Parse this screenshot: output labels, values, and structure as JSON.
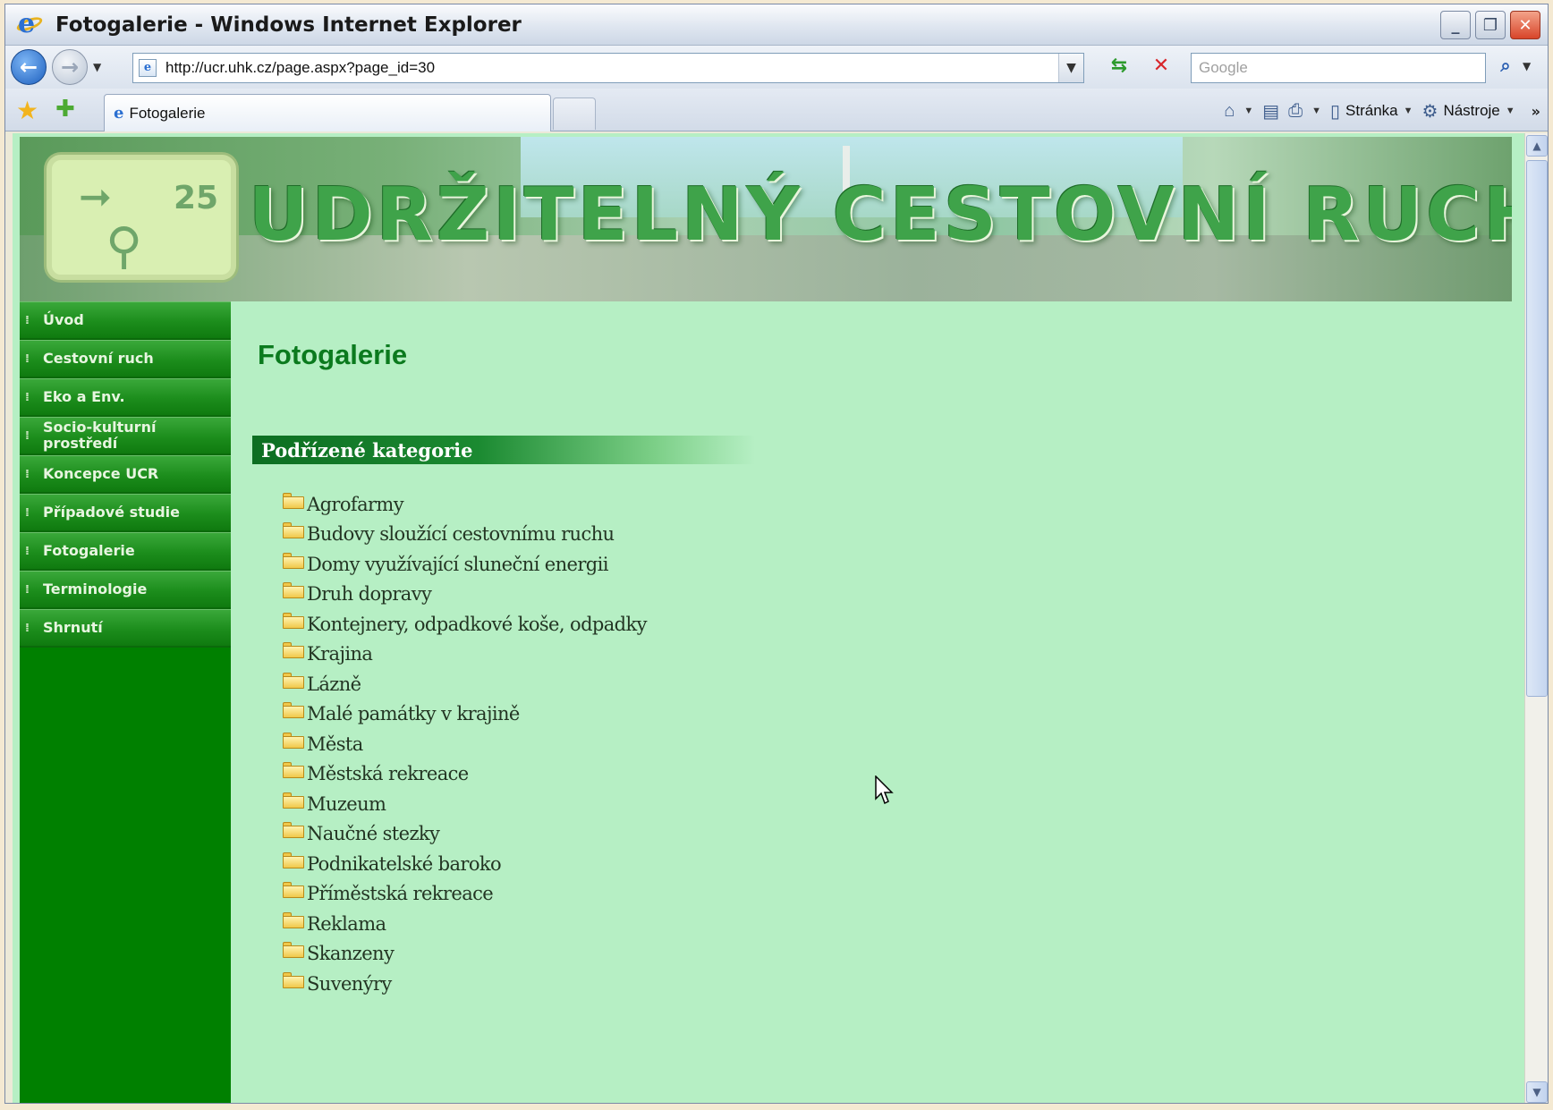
{
  "window": {
    "title": "Fotogalerie - Windows Internet Explorer"
  },
  "toolbar": {
    "url": "http://ucr.uhk.cz/page.aspx?page_id=30",
    "search_placeholder": "Google",
    "tab_label": "Fotogalerie",
    "page_menu": "Stránka",
    "tools_menu": "Nástroje"
  },
  "banner": {
    "title": "UDRŽITELNÝ CESTOVNÍ RUCH",
    "sign_number": "25"
  },
  "sidebar": {
    "items": [
      {
        "label": "Úvod"
      },
      {
        "label": "Cestovní ruch"
      },
      {
        "label": "Eko a Env."
      },
      {
        "label": "Socio-kulturní prostředí"
      },
      {
        "label": "Koncepce UCR"
      },
      {
        "label": "Případové studie"
      },
      {
        "label": "Fotogalerie"
      },
      {
        "label": "Terminologie"
      },
      {
        "label": "Shrnutí"
      }
    ]
  },
  "main": {
    "title": "Fotogalerie",
    "section_header": "Podřízené kategorie",
    "categories": [
      "Agrofarmy",
      "Budovy sloužící cestovnímu ruchu",
      "Domy využívající sluneční energii",
      "Druh dopravy",
      "Kontejnery, odpadkové koše, odpadky",
      "Krajina",
      "Lázně",
      "Malé památky v krajině",
      "Města",
      "Městská rekreace",
      "Muzeum",
      "Naučné stezky",
      "Podnikatelské baroko",
      "Příměstská rekreace",
      "Reklama",
      "Skanzeny",
      "Suvenýry"
    ]
  },
  "colors": {
    "page_bg": "#b6efc4",
    "sidebar_bg": "#008000",
    "title_green": "#0b7a1e"
  }
}
